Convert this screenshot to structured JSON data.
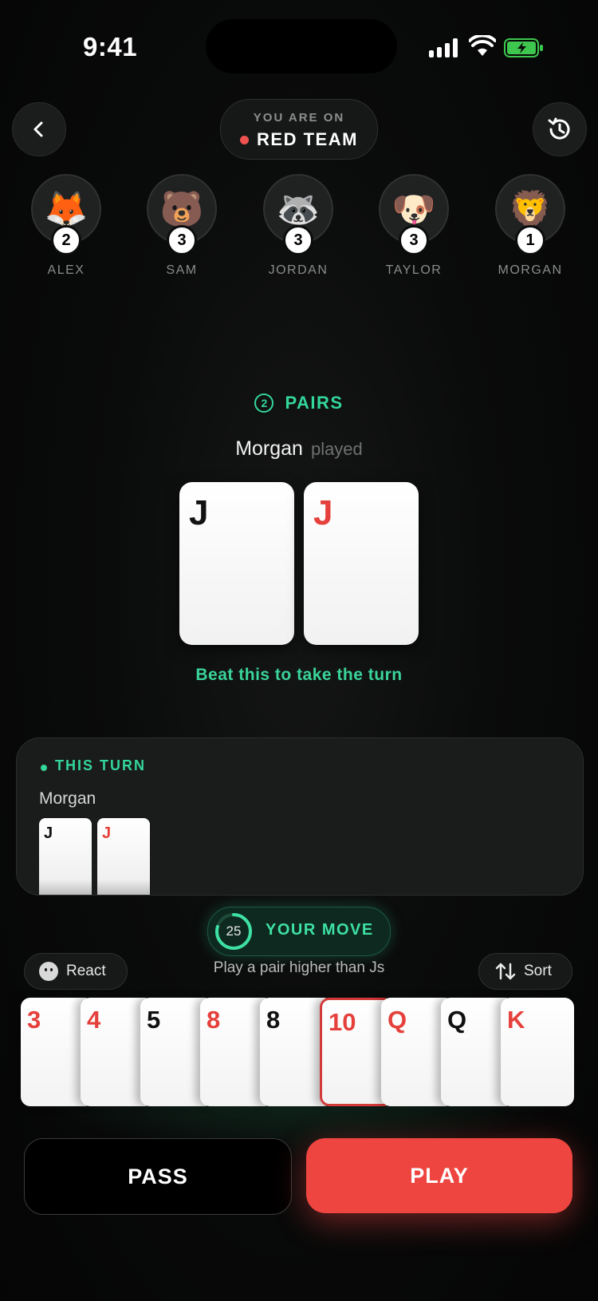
{
  "status_bar": {
    "time": "9:41"
  },
  "header": {
    "team_caption": "YOU ARE ON",
    "team_name": "RED TEAM",
    "team_color": "#ef5350"
  },
  "players": [
    {
      "name": "ALEX",
      "emoji": "🦊",
      "count": "2"
    },
    {
      "name": "SAM",
      "emoji": "🐻",
      "count": "3"
    },
    {
      "name": "JORDAN",
      "emoji": "🦝",
      "count": "3"
    },
    {
      "name": "TAYLOR",
      "emoji": "🐶",
      "count": "3"
    },
    {
      "name": "MORGAN",
      "emoji": "🦁",
      "count": "1"
    }
  ],
  "table": {
    "combo_count": "2",
    "combo_label": "PAIRS",
    "played_by": "Morgan",
    "played_word": "played",
    "cards": [
      {
        "rank": "J",
        "color": "black"
      },
      {
        "rank": "J",
        "color": "red"
      }
    ],
    "beat_text": "Beat this to take the turn"
  },
  "this_turn": {
    "label": "THIS TURN",
    "player": "Morgan",
    "cards": [
      {
        "rank": "J",
        "color": "black"
      },
      {
        "rank": "J",
        "color": "red"
      }
    ]
  },
  "your_move": {
    "timer": "25",
    "label": "YOUR MOVE",
    "hint": "Play a pair higher than Js"
  },
  "controls": {
    "react_label": "React",
    "sort_label": "Sort"
  },
  "hand": [
    {
      "rank": "3",
      "color": "red"
    },
    {
      "rank": "4",
      "color": "red"
    },
    {
      "rank": "5",
      "color": "black"
    },
    {
      "rank": "8",
      "color": "red"
    },
    {
      "rank": "8",
      "color": "black"
    },
    {
      "rank": "10",
      "color": "red",
      "selected": true
    },
    {
      "rank": "Q",
      "color": "red"
    },
    {
      "rank": "Q",
      "color": "black"
    },
    {
      "rank": "K",
      "color": "red"
    }
  ],
  "actions": {
    "pass_label": "PASS",
    "play_label": "PLAY"
  },
  "colors": {
    "accent_green": "#33d69b",
    "accent_red": "#ee4540"
  },
  "icons": [
    "back-icon",
    "history-icon",
    "smiley-icon",
    "sort-icon",
    "signal-icon",
    "wifi-icon",
    "battery-icon"
  ]
}
